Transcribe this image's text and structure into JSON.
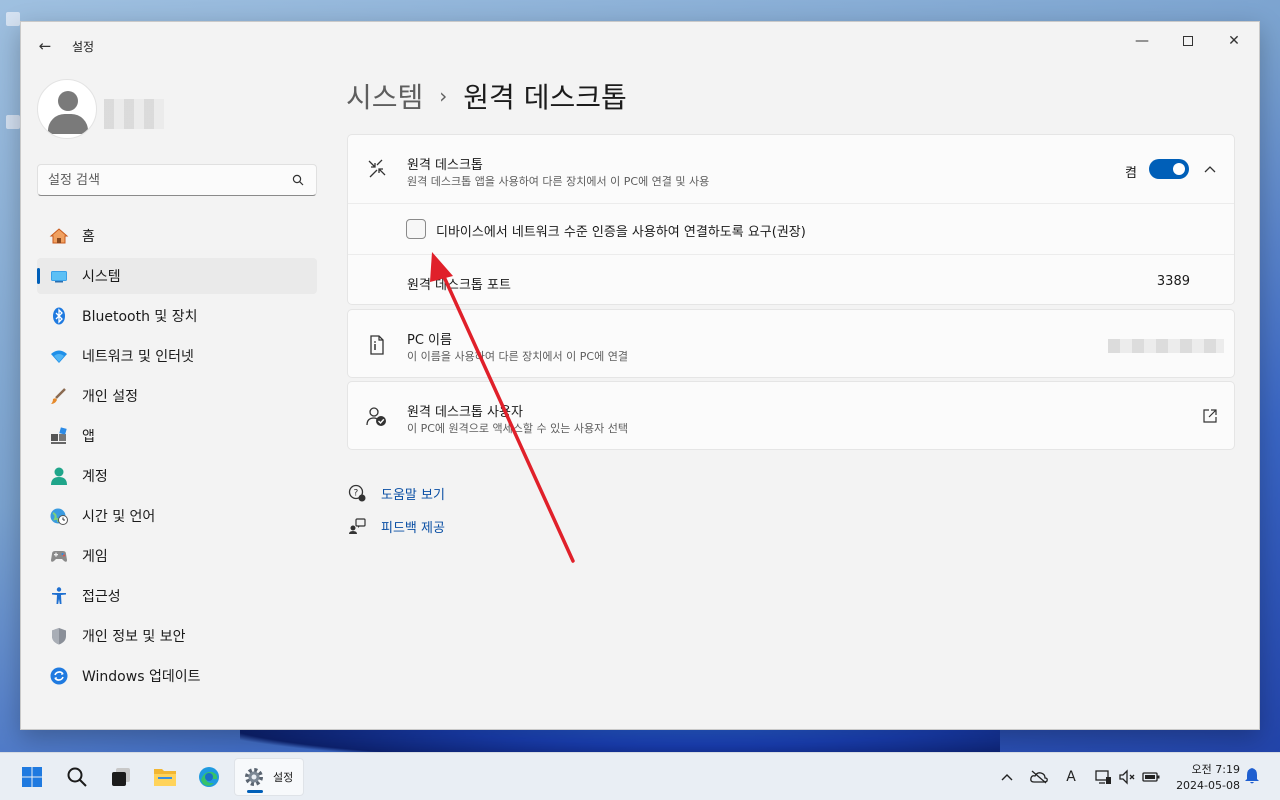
{
  "window": {
    "app_title": "설정",
    "back_label": "←",
    "controls": {
      "minimize": "—",
      "maximize": "",
      "close": "✕"
    }
  },
  "sidebar": {
    "search_placeholder": "설정 검색",
    "items": [
      {
        "label": "홈",
        "icon": "home-icon",
        "active": false
      },
      {
        "label": "시스템",
        "icon": "system-icon",
        "active": true
      },
      {
        "label": "Bluetooth 및 장치",
        "icon": "bluetooth-icon",
        "active": false
      },
      {
        "label": "네트워크 및 인터넷",
        "icon": "network-icon",
        "active": false
      },
      {
        "label": "개인 설정",
        "icon": "brush-icon",
        "active": false
      },
      {
        "label": "앱",
        "icon": "apps-icon",
        "active": false
      },
      {
        "label": "계정",
        "icon": "account-icon",
        "active": false
      },
      {
        "label": "시간 및 언어",
        "icon": "time-language-icon",
        "active": false
      },
      {
        "label": "게임",
        "icon": "gaming-icon",
        "active": false
      },
      {
        "label": "접근성",
        "icon": "accessibility-icon",
        "active": false
      },
      {
        "label": "개인 정보 및 보안",
        "icon": "shield-icon",
        "active": false
      },
      {
        "label": "Windows 업데이트",
        "icon": "update-icon",
        "active": false
      }
    ]
  },
  "breadcrumb": {
    "parent": "시스템",
    "separator": "›",
    "current": "원격 데스크톱"
  },
  "remote_desktop": {
    "title": "원격 데스크톱",
    "description": "원격 데스크톱 앱을 사용하여 다른 장치에서 이 PC에 연결 및 사용",
    "toggle_label": "켬",
    "toggle_on": true,
    "nla_checkbox_label": "디바이스에서 네트워크 수준 인증을 사용하여 연결하도록 요구(권장)",
    "nla_checked": false,
    "port_label": "원격 데스크톱 포트",
    "port_value": "3389"
  },
  "pc_name": {
    "title": "PC 이름",
    "description": "이 이름을 사용하여 다른 장치에서 이 PC에 연결"
  },
  "rd_users": {
    "title": "원격 데스크톱 사용자",
    "description": "이 PC에 원격으로 액세스할 수 있는 사용자 선택"
  },
  "help_links": {
    "help": "도움말 보기",
    "feedback": "피드백 제공"
  },
  "taskbar": {
    "settings_label": "설정",
    "clock_time": "오전 7:19",
    "clock_date": "2024-05-08",
    "tray_font_glyph": "A"
  },
  "colors": {
    "accent": "#005fb8",
    "link": "#0a4fa4",
    "annotation_arrow": "#e0202a"
  }
}
